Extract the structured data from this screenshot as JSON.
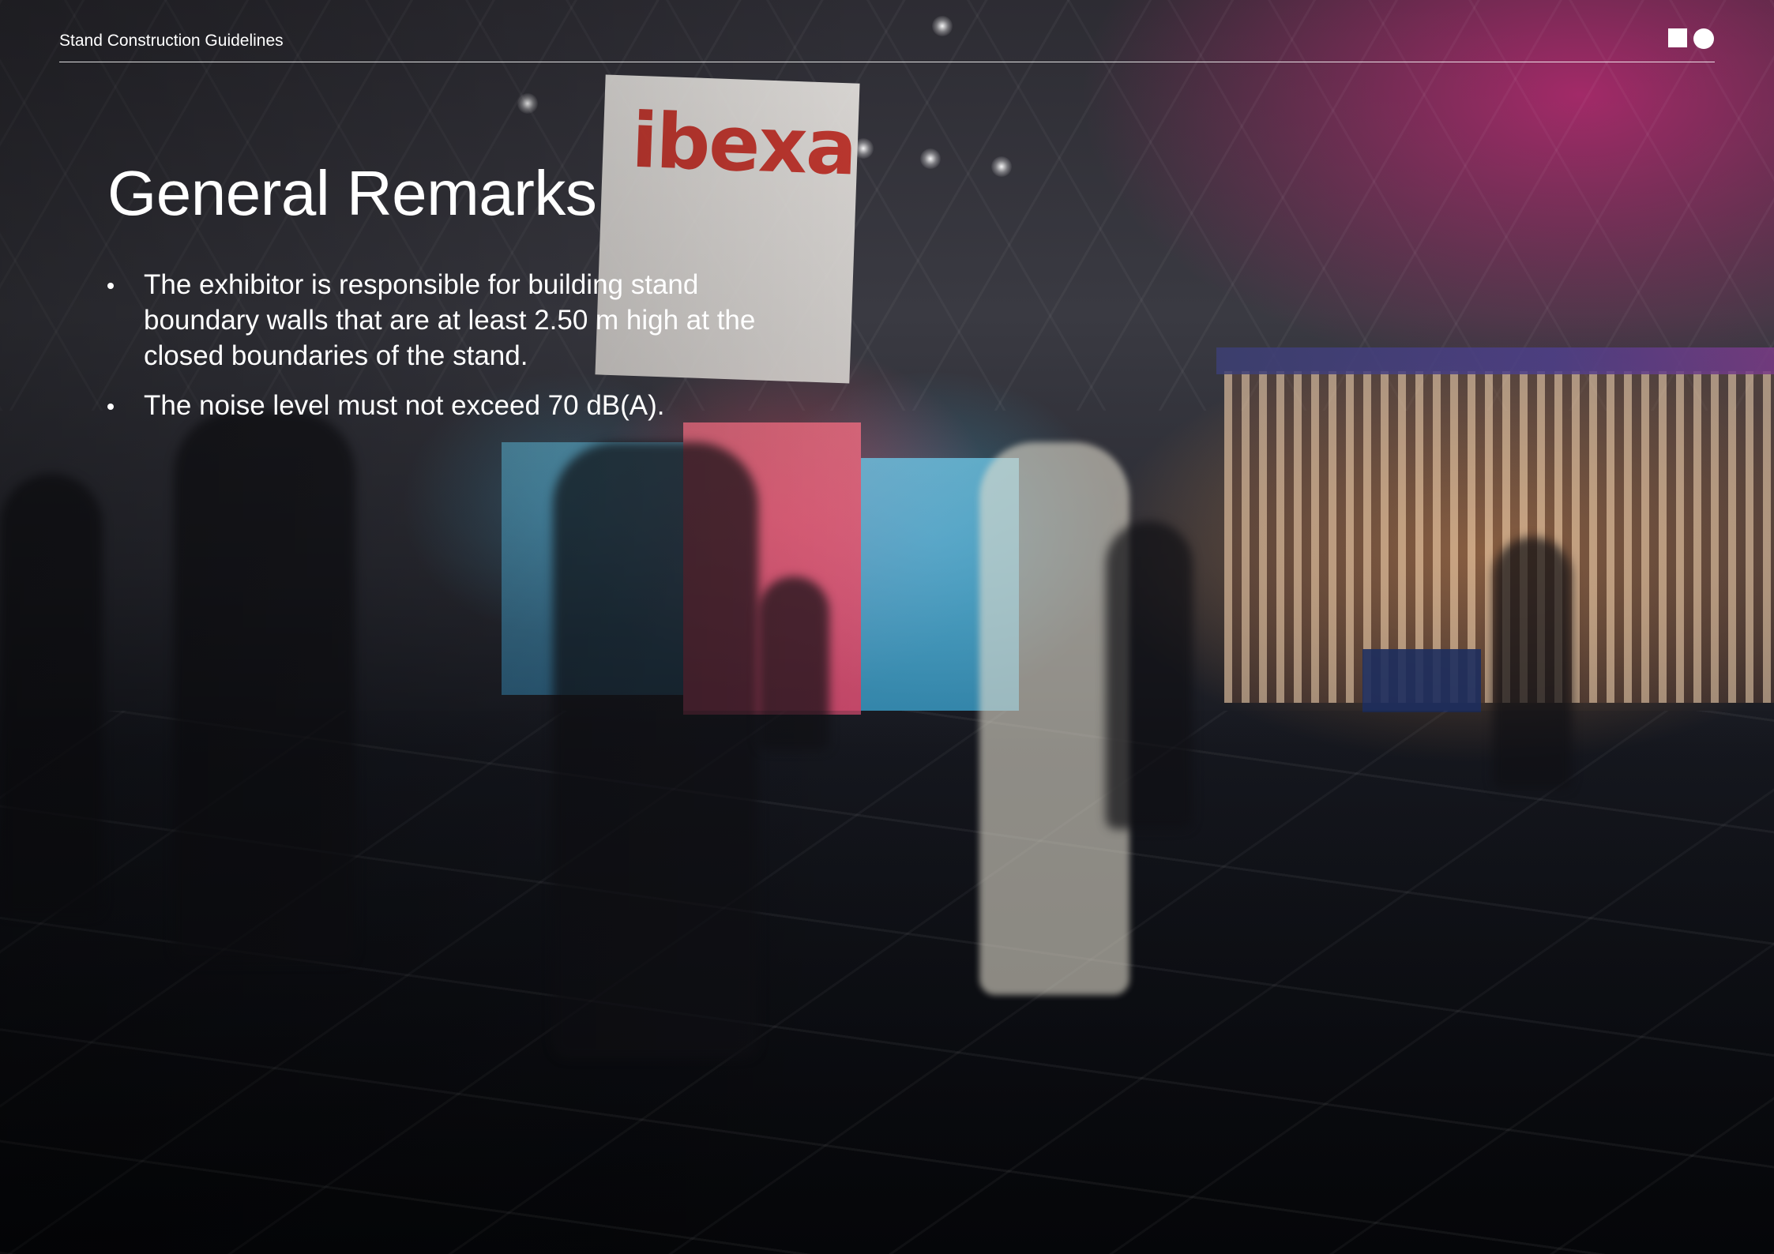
{
  "header": {
    "title": "Stand Construction Guidelines"
  },
  "main": {
    "heading": "General Remarks",
    "bullets": [
      {
        "text": "The exhibitor is responsible for building stand boundary walls that are at least 2.50 m high at the closed boundaries of the stand."
      },
      {
        "text": "The noise level must not exceed 70 dB(A)."
      }
    ]
  },
  "background": {
    "sign_logo": "ibexa"
  },
  "icons": {
    "brand_mark": "square-circle-logo-icon",
    "bullet": "bullet-dot-icon"
  },
  "colors": {
    "text": "#ffffff",
    "accent_magenta": "#c8287a",
    "logo_red": "#c8372d"
  }
}
